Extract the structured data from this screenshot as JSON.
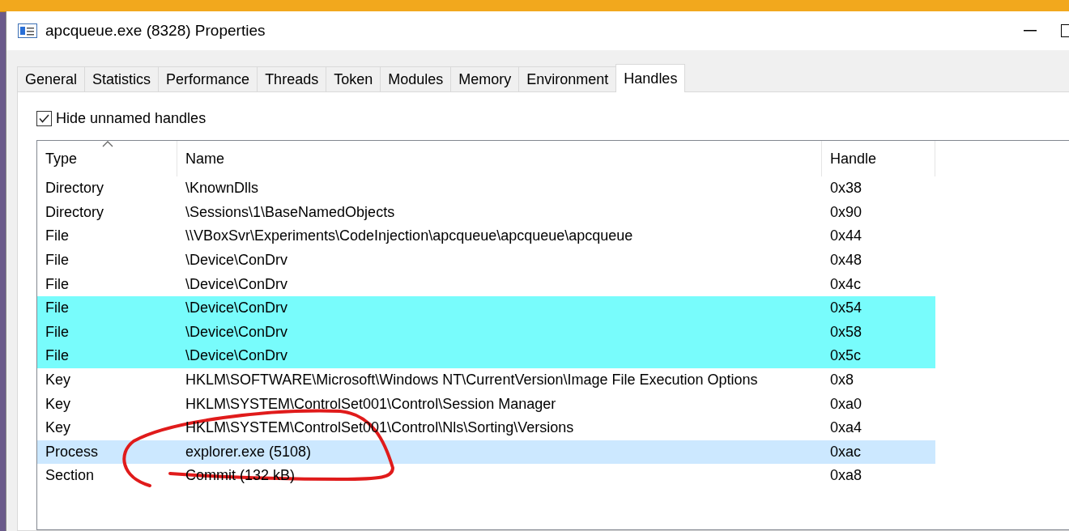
{
  "window": {
    "title": "apcqueue.exe (8328) Properties"
  },
  "tabs": [
    {
      "label": "General",
      "selected": false
    },
    {
      "label": "Statistics",
      "selected": false
    },
    {
      "label": "Performance",
      "selected": false
    },
    {
      "label": "Threads",
      "selected": false
    },
    {
      "label": "Token",
      "selected": false
    },
    {
      "label": "Modules",
      "selected": false
    },
    {
      "label": "Memory",
      "selected": false
    },
    {
      "label": "Environment",
      "selected": false
    },
    {
      "label": "Handles",
      "selected": true
    }
  ],
  "hide_unnamed": {
    "label": "Hide unnamed handles",
    "checked": true
  },
  "table": {
    "columns": [
      {
        "label": "Type",
        "sorted": true
      },
      {
        "label": "Name",
        "sorted": false
      },
      {
        "label": "Handle",
        "sorted": false
      }
    ],
    "rows": [
      {
        "type": "Directory",
        "name": "\\KnownDlls",
        "handle": "0x38",
        "highlighted": false,
        "selected": false
      },
      {
        "type": "Directory",
        "name": "\\Sessions\\1\\BaseNamedObjects",
        "handle": "0x90",
        "highlighted": false,
        "selected": false
      },
      {
        "type": "File",
        "name": "\\\\VBoxSvr\\Experiments\\CodeInjection\\apcqueue\\apcqueue\\apcqueue",
        "handle": "0x44",
        "highlighted": false,
        "selected": false
      },
      {
        "type": "File",
        "name": "\\Device\\ConDrv",
        "handle": "0x48",
        "highlighted": false,
        "selected": false
      },
      {
        "type": "File",
        "name": "\\Device\\ConDrv",
        "handle": "0x4c",
        "highlighted": false,
        "selected": false
      },
      {
        "type": "File",
        "name": "\\Device\\ConDrv",
        "handle": "0x54",
        "highlighted": true,
        "selected": false
      },
      {
        "type": "File",
        "name": "\\Device\\ConDrv",
        "handle": "0x58",
        "highlighted": true,
        "selected": false
      },
      {
        "type": "File",
        "name": "\\Device\\ConDrv",
        "handle": "0x5c",
        "highlighted": true,
        "selected": false
      },
      {
        "type": "Key",
        "name": "HKLM\\SOFTWARE\\Microsoft\\Windows NT\\CurrentVersion\\Image File Execution Options",
        "handle": "0x8",
        "highlighted": false,
        "selected": false
      },
      {
        "type": "Key",
        "name": "HKLM\\SYSTEM\\ControlSet001\\Control\\Session Manager",
        "handle": "0xa0",
        "highlighted": false,
        "selected": false
      },
      {
        "type": "Key",
        "name": "HKLM\\SYSTEM\\ControlSet001\\Control\\Nls\\Sorting\\Versions",
        "handle": "0xa4",
        "highlighted": false,
        "selected": false
      },
      {
        "type": "Process",
        "name": "explorer.exe (5108)",
        "handle": "0xac",
        "highlighted": false,
        "selected": true
      },
      {
        "type": "Section",
        "name": "Commit (132 kB)",
        "handle": "0xa8",
        "highlighted": false,
        "selected": false
      }
    ]
  }
}
